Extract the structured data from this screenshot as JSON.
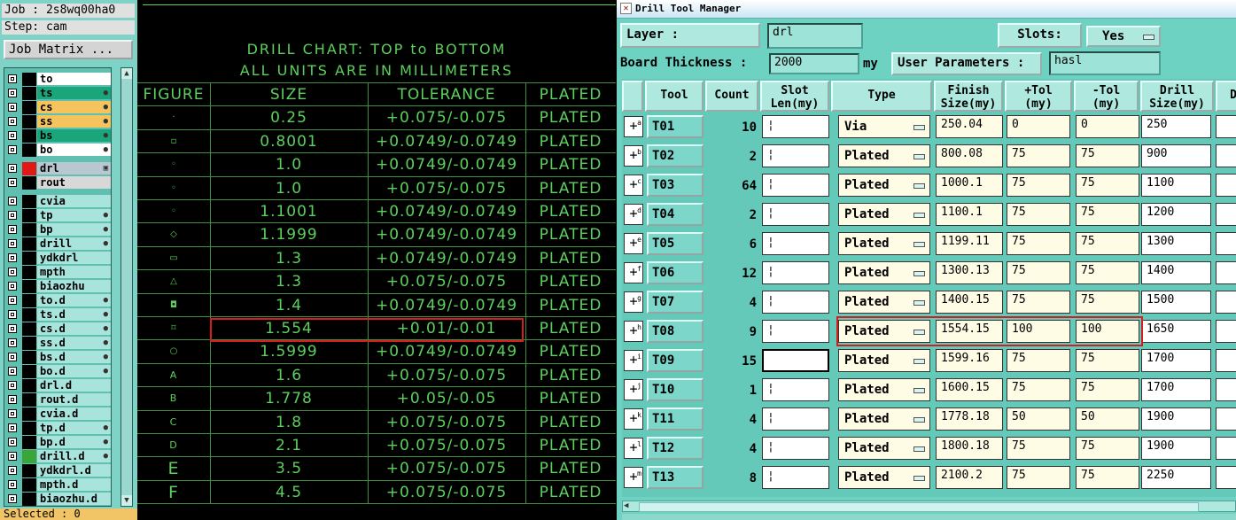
{
  "left_panel": {
    "job": "Job : 2s8wq00ha0",
    "step": "Step: cam",
    "job_matrix": "Job Matrix ...",
    "selected": "Selected : 0",
    "layers": [
      {
        "name": "to",
        "color": "#ffffff"
      },
      {
        "name": "ts",
        "color": "#1aa57a"
      },
      {
        "name": "cs",
        "color": "#f5c45e"
      },
      {
        "name": "ss",
        "color": "#f5c45e"
      },
      {
        "name": "bs",
        "color": "#1aa57a"
      },
      {
        "name": "bo",
        "color": "#ffffff"
      },
      {
        "name": "drl",
        "color": "#b9c7d1"
      },
      {
        "name": "rout",
        "color": "#d8d8d8"
      },
      {
        "name": "cvia",
        "color": "#a8e4dc"
      },
      {
        "name": "tp",
        "color": "#a8e4dc"
      },
      {
        "name": "bp",
        "color": "#a8e4dc"
      },
      {
        "name": "drill",
        "color": "#a8e4dc"
      },
      {
        "name": "ydkdrl",
        "color": "#a8e4dc"
      },
      {
        "name": "mpth",
        "color": "#a8e4dc"
      },
      {
        "name": "biaozhu",
        "color": "#a8e4dc"
      },
      {
        "name": "to.d",
        "color": "#a8e4dc"
      },
      {
        "name": "ts.d",
        "color": "#a8e4dc"
      },
      {
        "name": "cs.d",
        "color": "#a8e4dc"
      },
      {
        "name": "ss.d",
        "color": "#a8e4dc"
      },
      {
        "name": "bs.d",
        "color": "#a8e4dc"
      },
      {
        "name": "bo.d",
        "color": "#a8e4dc"
      },
      {
        "name": "drl.d",
        "color": "#a8e4dc"
      },
      {
        "name": "rout.d",
        "color": "#a8e4dc"
      },
      {
        "name": "cvia.d",
        "color": "#a8e4dc"
      },
      {
        "name": "tp.d",
        "color": "#a8e4dc"
      },
      {
        "name": "bp.d",
        "color": "#a8e4dc"
      },
      {
        "name": "drill.d",
        "color": "#a8e4dc"
      },
      {
        "name": "ydkdrl.d",
        "color": "#a8e4dc"
      },
      {
        "name": "mpth.d",
        "color": "#a8e4dc"
      },
      {
        "name": "biaozhu.d",
        "color": "#a8e4dc"
      }
    ]
  },
  "drill_chart": {
    "title1": "DRILL CHART: TOP to BOTTOM",
    "title2": "ALL UNITS ARE IN MILLIMETERS",
    "headers": [
      "FIGURE",
      "SIZE",
      "TOLERANCE",
      "PLATED"
    ],
    "rows": [
      {
        "figure": "·",
        "size": "0.25",
        "tolerance": "+0.075/-0.075",
        "plated": "PLATED"
      },
      {
        "figure": "▫",
        "size": "0.8001",
        "tolerance": "+0.0749/-0.0749",
        "plated": "PLATED"
      },
      {
        "figure": "◦",
        "size": "1.0",
        "tolerance": "+0.0749/-0.0749",
        "plated": "PLATED"
      },
      {
        "figure": "◦",
        "size": "1.0",
        "tolerance": "+0.075/-0.075",
        "plated": "PLATED"
      },
      {
        "figure": "◦",
        "size": "1.1001",
        "tolerance": "+0.0749/-0.0749",
        "plated": "PLATED"
      },
      {
        "figure": "◇",
        "size": "1.1999",
        "tolerance": "+0.0749/-0.0749",
        "plated": "PLATED"
      },
      {
        "figure": "▭",
        "size": "1.3",
        "tolerance": "+0.0749/-0.0749",
        "plated": "PLATED"
      },
      {
        "figure": "△",
        "size": "1.3",
        "tolerance": "+0.075/-0.075",
        "plated": "PLATED"
      },
      {
        "figure": "◘",
        "size": "1.4",
        "tolerance": "+0.0749/-0.0749",
        "plated": "PLATED"
      },
      {
        "figure": "⌑",
        "size": "1.554",
        "tolerance": "+0.01/-0.01",
        "plated": "PLATED"
      },
      {
        "figure": "○",
        "size": "1.5999",
        "tolerance": "+0.0749/-0.0749",
        "plated": "PLATED"
      },
      {
        "figure": "A",
        "size": "1.6",
        "tolerance": "+0.075/-0.075",
        "plated": "PLATED"
      },
      {
        "figure": "B",
        "size": "1.778",
        "tolerance": "+0.05/-0.05",
        "plated": "PLATED"
      },
      {
        "figure": "C",
        "size": "1.8",
        "tolerance": "+0.075/-0.075",
        "plated": "PLATED"
      },
      {
        "figure": "D",
        "size": "2.1",
        "tolerance": "+0.075/-0.075",
        "plated": "PLATED"
      },
      {
        "figure": "E",
        "size": "3.5",
        "tolerance": "+0.075/-0.075",
        "plated": "PLATED"
      },
      {
        "figure": "F",
        "size": "4.5",
        "tolerance": "+0.075/-0.075",
        "plated": "PLATED"
      }
    ]
  },
  "dtm": {
    "window_title": "Drill Tool Manager",
    "layer_label": "Layer          :",
    "layer_value": "drl",
    "slots_label": "Slots:",
    "slots_value": "Yes",
    "board_thickness_label": "Board Thickness :",
    "board_thickness_value": "2000",
    "board_thickness_unit": "my",
    "user_params_label": "User Parameters :",
    "user_params_value": "hasl",
    "headers": [
      {
        "l1": "Tool",
        "l2": ""
      },
      {
        "l1": "Count",
        "l2": ""
      },
      {
        "l1": "Slot",
        "l2": "Len(my)"
      },
      {
        "l1": "Type",
        "l2": ""
      },
      {
        "l1": "Finish",
        "l2": "Size(my)"
      },
      {
        "l1": "+Tol",
        "l2": "(my)"
      },
      {
        "l1": "-Tol",
        "l2": "(my)"
      },
      {
        "l1": "Drill",
        "l2": "Size(my)"
      },
      {
        "l1": "D",
        "l2": ""
      }
    ],
    "rows": [
      {
        "mark": "a",
        "tool": "T01",
        "count": "10",
        "type": "Via",
        "finish": "250.04",
        "ptol": "0",
        "mtol": "0",
        "drill": "250"
      },
      {
        "mark": "b",
        "tool": "T02",
        "count": "2",
        "type": "Plated",
        "finish": "800.08",
        "ptol": "75",
        "mtol": "75",
        "drill": "900"
      },
      {
        "mark": "c",
        "tool": "T03",
        "count": "64",
        "type": "Plated",
        "finish": "1000.1",
        "ptol": "75",
        "mtol": "75",
        "drill": "1100"
      },
      {
        "mark": "d",
        "tool": "T04",
        "count": "2",
        "type": "Plated",
        "finish": "1100.1",
        "ptol": "75",
        "mtol": "75",
        "drill": "1200"
      },
      {
        "mark": "e",
        "tool": "T05",
        "count": "6",
        "type": "Plated",
        "finish": "1199.11",
        "ptol": "75",
        "mtol": "75",
        "drill": "1300"
      },
      {
        "mark": "f",
        "tool": "T06",
        "count": "12",
        "type": "Plated",
        "finish": "1300.13",
        "ptol": "75",
        "mtol": "75",
        "drill": "1400"
      },
      {
        "mark": "g",
        "tool": "T07",
        "count": "4",
        "type": "Plated",
        "finish": "1400.15",
        "ptol": "75",
        "mtol": "75",
        "drill": "1500"
      },
      {
        "mark": "h",
        "tool": "T08",
        "count": "9",
        "type": "Plated",
        "finish": "1554.15",
        "ptol": "100",
        "mtol": "100",
        "drill": "1650"
      },
      {
        "mark": "i",
        "tool": "T09",
        "count": "15",
        "type": "Plated",
        "finish": "1599.16",
        "ptol": "75",
        "mtol": "75",
        "drill": "1700"
      },
      {
        "mark": "j",
        "tool": "T10",
        "count": "1",
        "type": "Plated",
        "finish": "1600.15",
        "ptol": "75",
        "mtol": "75",
        "drill": "1700"
      },
      {
        "mark": "k",
        "tool": "T11",
        "count": "4",
        "type": "Plated",
        "finish": "1778.18",
        "ptol": "50",
        "mtol": "50",
        "drill": "1900"
      },
      {
        "mark": "l",
        "tool": "T12",
        "count": "4",
        "type": "Plated",
        "finish": "1800.18",
        "ptol": "75",
        "mtol": "75",
        "drill": "1900"
      },
      {
        "mark": "m",
        "tool": "T13",
        "count": "8",
        "type": "Plated",
        "finish": "2100.2",
        "ptol": "75",
        "mtol": "75",
        "drill": "2250"
      }
    ]
  }
}
